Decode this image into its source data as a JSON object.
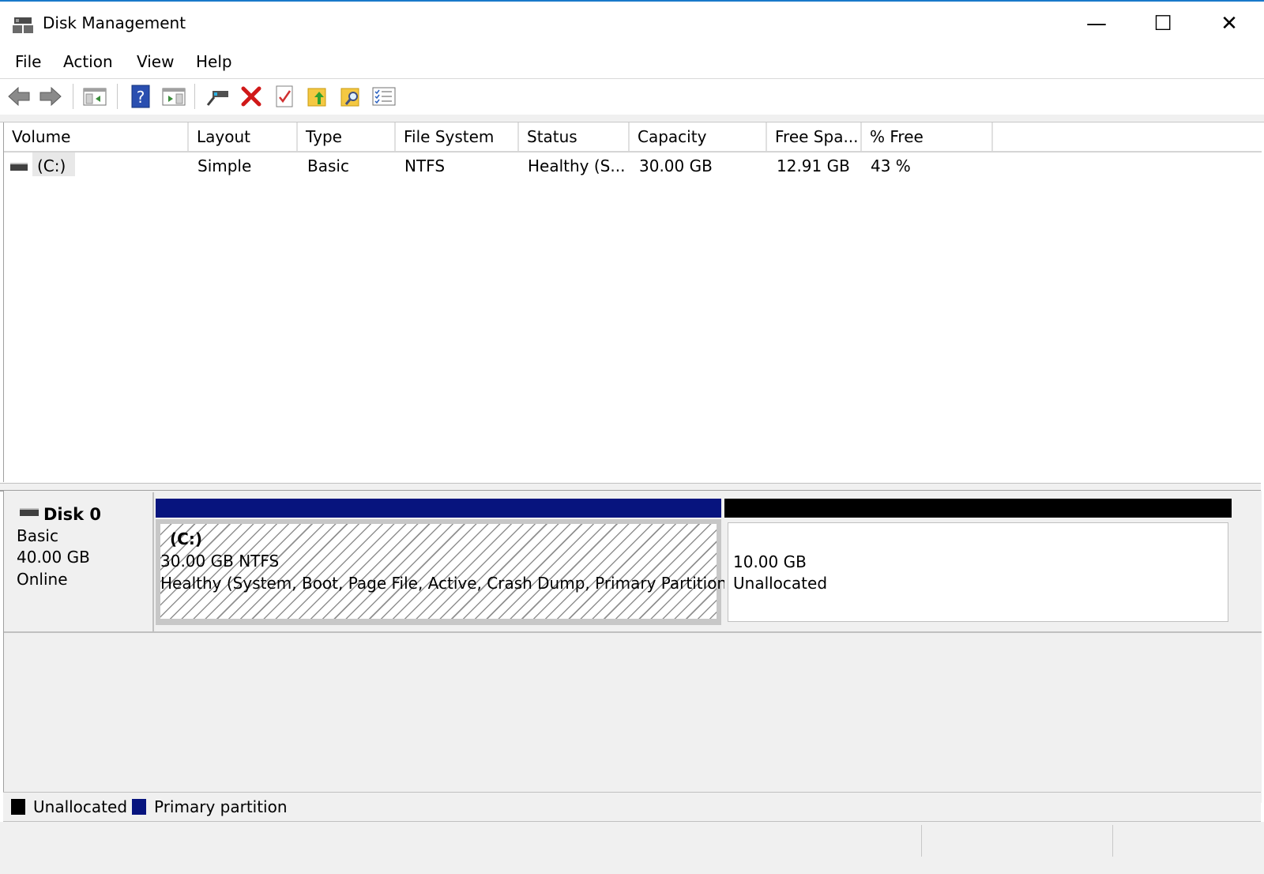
{
  "window": {
    "title": "Disk Management",
    "icon": "disk-management-icon",
    "controls": {
      "minimize": "—",
      "maximize": "☐",
      "close": "✕"
    }
  },
  "menu": [
    "File",
    "Action",
    "View",
    "Help"
  ],
  "toolbar": {
    "buttons": [
      "back-arrow-icon",
      "forward-arrow-icon",
      "show-hide-console-tree-icon",
      "help-icon",
      "show-hide-action-pane-icon",
      "connect-drive-icon",
      "delete-icon",
      "check-properties-icon",
      "folder-up-icon",
      "folder-search-icon",
      "list-view-icon"
    ]
  },
  "volumes": {
    "columns": [
      "Volume",
      "Layout",
      "Type",
      "File System",
      "Status",
      "Capacity",
      "Free Spa...",
      "% Free"
    ],
    "rows": [
      {
        "volume": "(C:)",
        "layout": "Simple",
        "type": "Basic",
        "file_system": "NTFS",
        "status": "Healthy (S...",
        "capacity": "30.00 GB",
        "free_space": "12.91 GB",
        "percent_free": "43 %"
      }
    ]
  },
  "disk": {
    "name": "Disk 0",
    "type": "Basic",
    "size": "40.00 GB",
    "state": "Online",
    "partitions": [
      {
        "label": "(C:)",
        "size_fs": "30.00 GB NTFS",
        "status": "Healthy (System, Boot, Page File, Active, Crash Dump, Primary Partition)",
        "color": "#07147e"
      },
      {
        "size": "10.00 GB",
        "status": "Unallocated",
        "color": "#000000"
      }
    ]
  },
  "legend": [
    {
      "label": "Unallocated",
      "color": "#000000"
    },
    {
      "label": "Primary partition",
      "color": "#07147e"
    }
  ]
}
